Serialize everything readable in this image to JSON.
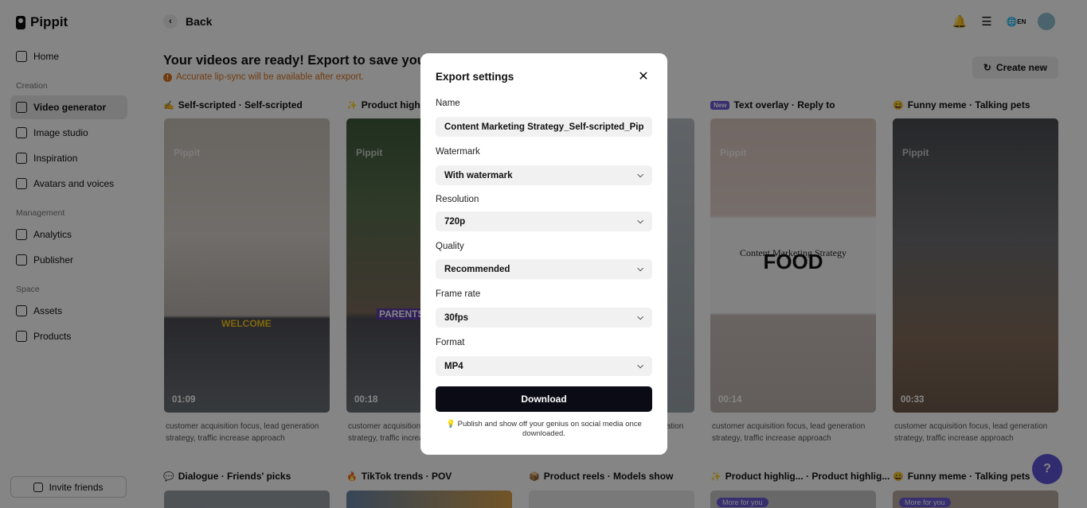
{
  "app": {
    "name": "Pippit"
  },
  "sidebar": {
    "home": "Home",
    "sections": {
      "creation": "Creation",
      "management": "Management",
      "space": "Space"
    },
    "creation_items": [
      "Video generator",
      "Image studio",
      "Inspiration",
      "Avatars and voices"
    ],
    "management_items": [
      "Analytics",
      "Publisher"
    ],
    "space_items": [
      "Assets",
      "Products"
    ],
    "invite": "Invite friends"
  },
  "header": {
    "back": "Back",
    "title": "Your videos are ready! Export to save your",
    "warning": "Accurate lip-sync will be available after export.",
    "create_new": "Create new",
    "lang": "EN"
  },
  "cards": [
    {
      "label": "Self-scripted · Self-scripted",
      "duration": "01:09",
      "caption": "WELCOME",
      "desc": "customer acquisition focus, lead generation strategy, traffic increase approach"
    },
    {
      "label": "Product highlig",
      "duration": "00:18",
      "caption": "PARENTS",
      "desc": "customer acquisition focus, lead generation strategy, traffic increase approach"
    },
    {
      "label": "",
      "duration": "",
      "desc": "customer acquisition focus, lead generation strategy, traffic increase approach"
    },
    {
      "label": "Text overlay · Reply to",
      "badge": "New",
      "duration": "00:14",
      "overlay": "Content Marketing Strategy",
      "food": "FOOD",
      "desc": "customer acquisition focus, lead generation strategy, traffic increase approach"
    },
    {
      "label": "Funny meme · Talking pets",
      "duration": "00:33",
      "desc": "customer acquisition focus, lead generation strategy, traffic increase approach"
    }
  ],
  "watermark": "Pippit",
  "row2": [
    "Dialogue · Friends' picks",
    "TikTok trends · POV",
    "Product reels · Models show",
    "Product highlig... · Product highlig...",
    "Funny meme · Talking pets"
  ],
  "more_for_you": "More for you",
  "modal": {
    "title": "Export settings",
    "name_label": "Name",
    "name_value": "Content Marketing Strategy_Self-scripted_Pippit",
    "watermark_label": "Watermark",
    "watermark_value": "With watermark",
    "resolution_label": "Resolution",
    "resolution_value": "720p",
    "quality_label": "Quality",
    "quality_value": "Recommended",
    "framerate_label": "Frame rate",
    "framerate_value": "30fps",
    "format_label": "Format",
    "format_value": "MP4",
    "download": "Download",
    "tip": "Publish and show off your genius on social media once downloaded."
  },
  "help": "?"
}
